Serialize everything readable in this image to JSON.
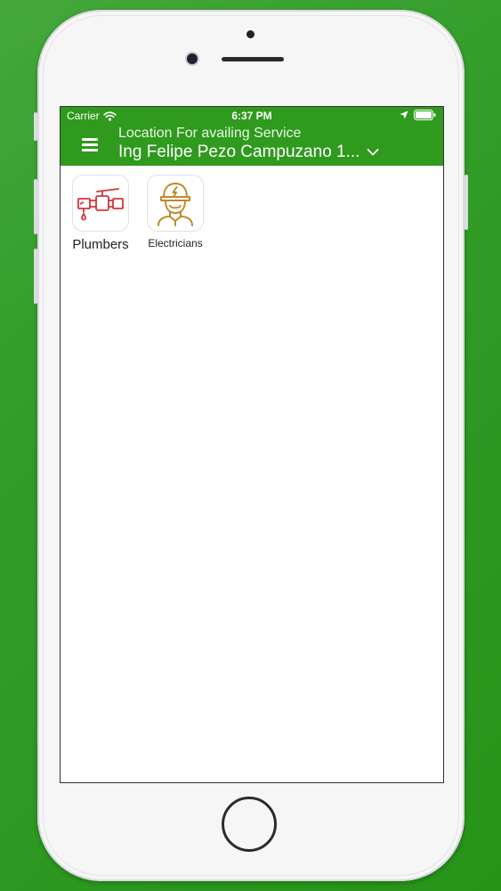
{
  "colors": {
    "brand_green": "#2f9a1d",
    "plumber_icon": "#d0353a",
    "electrician_icon": "#c08a2e"
  },
  "statusbar": {
    "carrier": "Carrier",
    "time": "6:37 PM",
    "wifi_icon": "wifi-icon",
    "location_icon": "location-arrow-icon",
    "battery_icon": "battery-icon"
  },
  "header": {
    "menu_icon": "hamburger-menu-icon",
    "location_caption": "Location For availing Service",
    "location_value": "Ing Felipe Pezo Campuzano 1...",
    "dropdown_icon": "chevron-down-icon"
  },
  "services": [
    {
      "label": "Plumbers",
      "icon": "faucet-icon"
    },
    {
      "label": "Electricians",
      "icon": "electrician-icon"
    }
  ]
}
